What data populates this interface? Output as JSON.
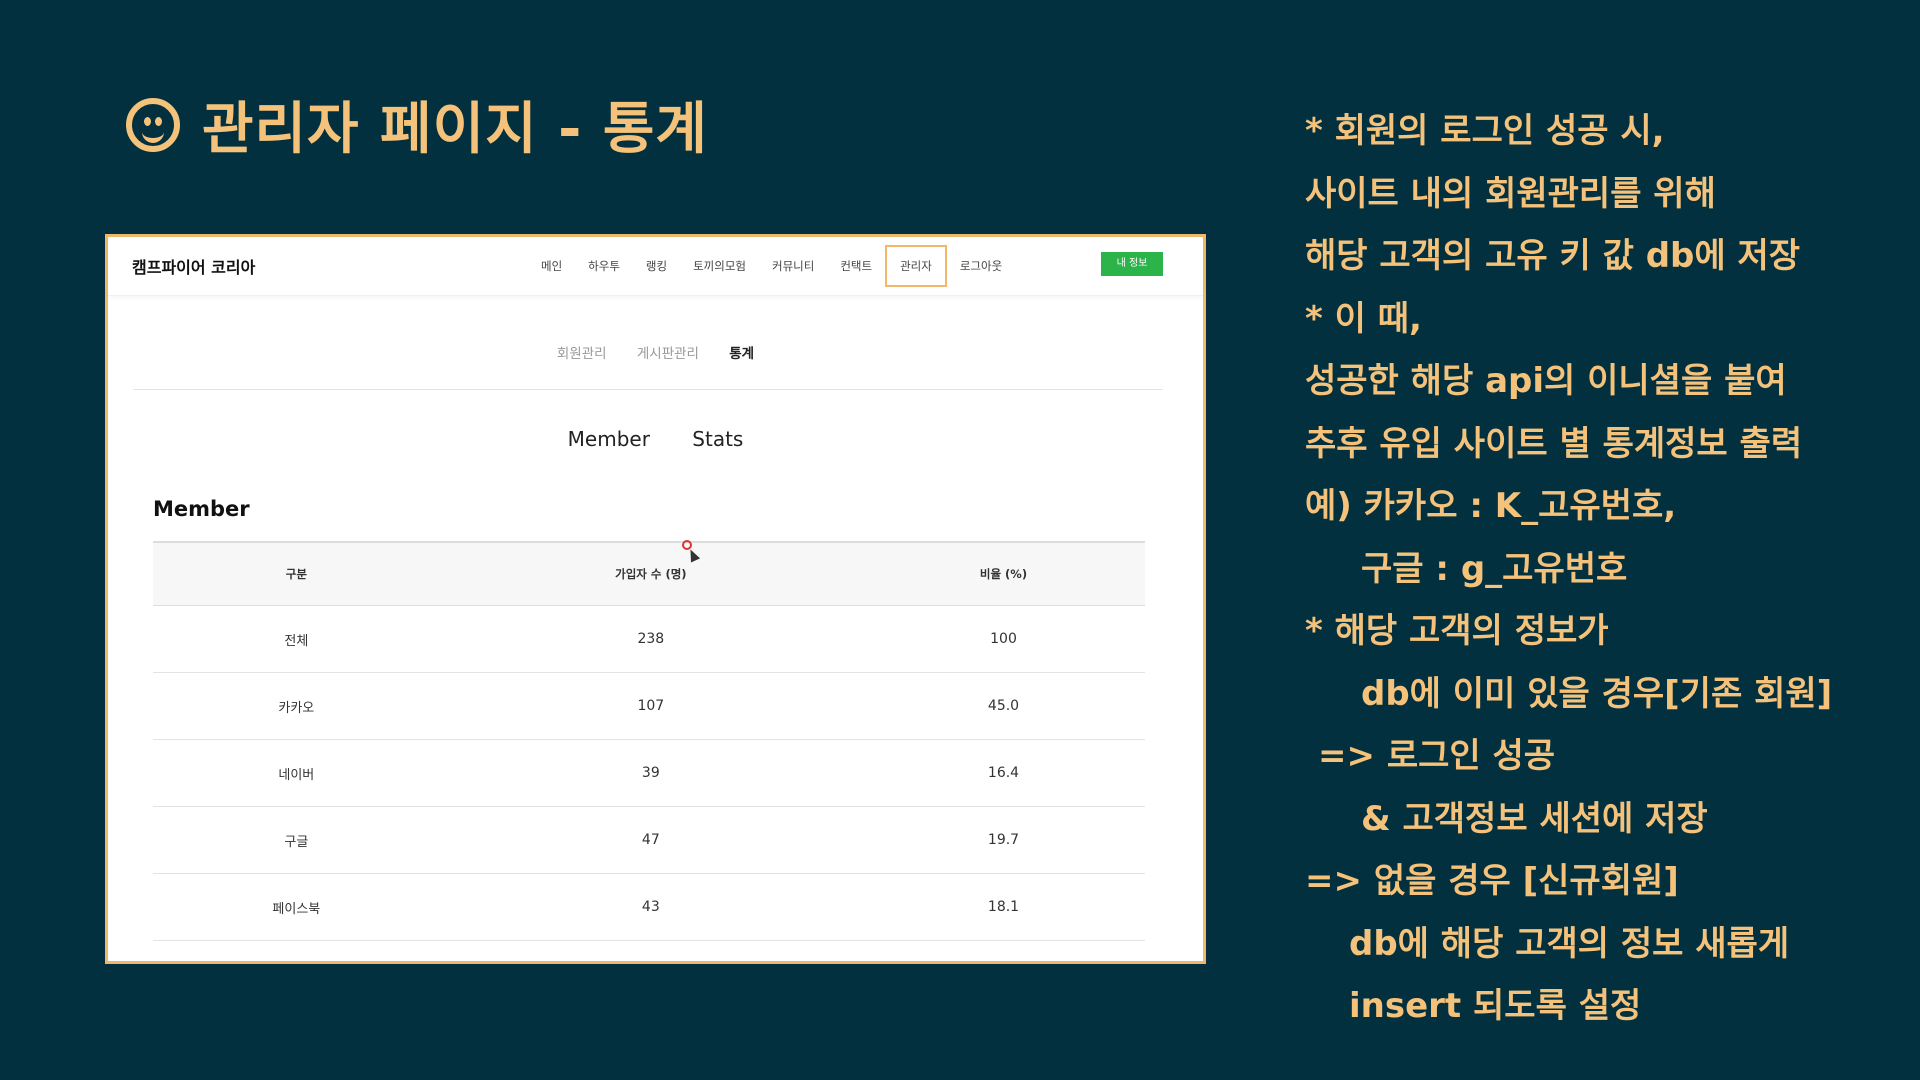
{
  "slide": {
    "title_icon": "smiley-icon",
    "title": "관리자 페이지 - 통계",
    "accent_color": "#f4c27a",
    "background_color": "#03303f"
  },
  "site": {
    "brand": "캠프파이어 코리아",
    "nav": [
      "메인",
      "하우투",
      "랭킹",
      "토끼의모험",
      "커뮤니티",
      "컨택트",
      "관리자",
      "로그아웃"
    ],
    "active_nav": "관리자",
    "my_info_button": "내 정보",
    "subnav": [
      "회원관리",
      "게시판관리",
      "통계"
    ],
    "active_subnav": "통계",
    "stat_tabs": [
      "Member",
      "Stats"
    ],
    "section_title": "Member",
    "table": {
      "headers": [
        "구분",
        "가입자 수 (명)",
        "비율 (%)"
      ],
      "rows": [
        [
          "전체",
          "238",
          "100"
        ],
        [
          "카카오",
          "107",
          "45.0"
        ],
        [
          "네이버",
          "39",
          "16.4"
        ],
        [
          "구글",
          "47",
          "19.7"
        ],
        [
          "페이스북",
          "43",
          "18.1"
        ]
      ]
    }
  },
  "notes": [
    "* 회원의 로그인 성공 시,",
    "사이트 내의 회원관리를 위해",
    "해당 고객의 고유 키 값 db에 저장",
    "* 이 때,",
    "성공한 해당 api의 이니셜을 붙여",
    "추후 유입 사이트 별 통계정보 출력",
    "예) 카카오 :  K_고유번호,",
    "구글 :  g_고유번호",
    "* 해당 고객의 정보가",
    "db에 이미 있을 경우[기존 회원]",
    "=> 로그인 성공",
    "& 고객정보 세션에 저장",
    "=> 없을 경우 [신규회원]",
    "db에 해당 고객의 정보 새롭게",
    "insert 되도록 설정"
  ]
}
